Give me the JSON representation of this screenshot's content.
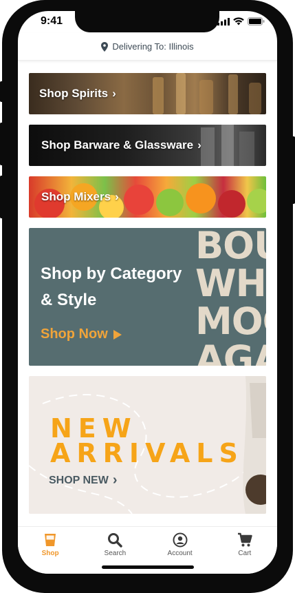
{
  "status_bar": {
    "time": "9:41"
  },
  "header": {
    "delivering_label": "Delivering To: Illinois"
  },
  "banners": {
    "spirits": "Shop Spirits",
    "barware": "Shop Barware & Glassware",
    "mixers": "Shop Mixers",
    "category": {
      "title_line1": "Shop by Category",
      "title_line2": "& Style",
      "cta": "Shop Now",
      "image_text": [
        "BOU",
        "WHI",
        "MOO",
        "AGA"
      ]
    },
    "new_arrivals": {
      "line1": "NEW",
      "line2": "ARRIVALS",
      "cta": "SHOP NEW"
    }
  },
  "tabbar": {
    "items": [
      {
        "label": "Shop",
        "icon": "glass-icon",
        "active": true
      },
      {
        "label": "Search",
        "icon": "search-icon",
        "active": false
      },
      {
        "label": "Account",
        "icon": "account-icon",
        "active": false
      },
      {
        "label": "Cart",
        "icon": "cart-icon",
        "active": false
      }
    ]
  },
  "colors": {
    "accent": "#f0972a",
    "category_bg": "#566d70",
    "new_arrivals_text": "#f6a418"
  }
}
